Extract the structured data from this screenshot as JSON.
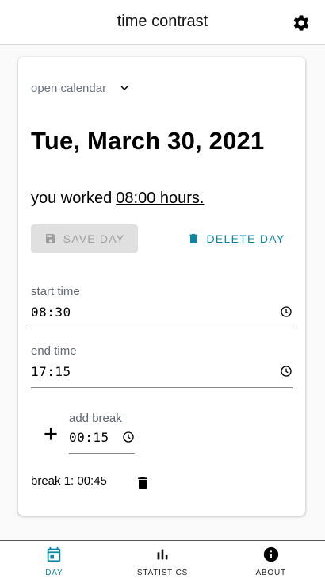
{
  "app": {
    "title": "time contrast"
  },
  "calendar": {
    "toggle_label": "open calendar"
  },
  "day": {
    "date": "Tue, March 30, 2021",
    "worked_prefix": "you worked",
    "worked_hours": "08:00 hours."
  },
  "actions": {
    "save_label": "SAVE DAY",
    "delete_label": "DELETE DAY"
  },
  "start": {
    "label": "start time",
    "value": "08:30"
  },
  "end": {
    "label": "end time",
    "value": "17:15"
  },
  "break_input": {
    "label": "add break",
    "value": "00:15"
  },
  "breaks": [
    {
      "text": "break 1: 00:45"
    }
  ],
  "nav": [
    {
      "label": "DAY",
      "icon": "calendar-icon",
      "active": true
    },
    {
      "label": "STATISTICS",
      "icon": "bar-chart-icon",
      "active": false
    },
    {
      "label": "ABOUT",
      "icon": "info-icon",
      "active": false
    }
  ],
  "colors": {
    "accent": "#0a87a5",
    "disabled_bg": "#e0e0e0",
    "disabled_text": "#9e9e9e"
  }
}
